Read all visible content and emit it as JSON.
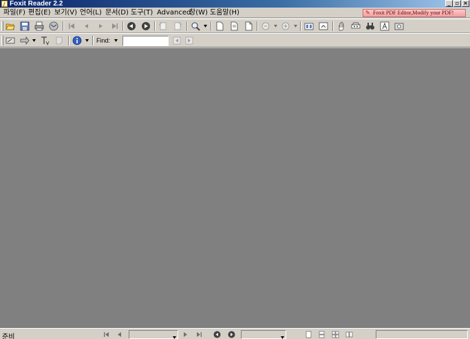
{
  "window": {
    "title": "Foxit Reader 2.2",
    "minimize_label": "_",
    "restore_label": "▫",
    "close_label": "×"
  },
  "menu": {
    "items": [
      {
        "label": "파일(F)"
      },
      {
        "label": "편집(E)"
      },
      {
        "label": "보기(V)"
      },
      {
        "label": "언어(L)"
      },
      {
        "label": "문서(D)"
      },
      {
        "label": "도구(T)"
      },
      {
        "label": "Advanced"
      },
      {
        "label": "창(W)"
      },
      {
        "label": "도움말(H)"
      }
    ]
  },
  "ad_banner": {
    "text": "Foxit PDF Editor,Modify your PDF!"
  },
  "toolbar2": {
    "find_label": "Find:",
    "find_value": ""
  },
  "statusbar": {
    "status": "준비",
    "page_value": "",
    "zoom_value": ""
  },
  "colors": {
    "document_background": "#808080",
    "chrome": "#d4d0c8",
    "title_gradient_start": "#0a246a",
    "ad_background": "#f0a0a0"
  },
  "icons": {
    "toolbar1": [
      "open-icon",
      "save-icon",
      "print-icon",
      "email-icon",
      "first-page-icon",
      "previous-page-icon",
      "next-page-icon",
      "last-page-icon",
      "back-icon",
      "forward-icon",
      "rotate-left-icon",
      "rotate-right-icon",
      "zoom-icon",
      "single-page-icon",
      "continuous-page-icon",
      "facing-page-icon",
      "zoom-out-icon",
      "zoom-in-icon",
      "fit-width-icon",
      "fit-page-icon",
      "hand-tool-icon",
      "select-text-icon",
      "binoculars-icon",
      "text-tool-icon",
      "snapshot-icon"
    ],
    "toolbar2": [
      "annotation-icon",
      "arrow-tool-icon",
      "typewriter-icon",
      "note-icon",
      "info-icon",
      "find-previous-icon",
      "find-next-icon"
    ]
  }
}
